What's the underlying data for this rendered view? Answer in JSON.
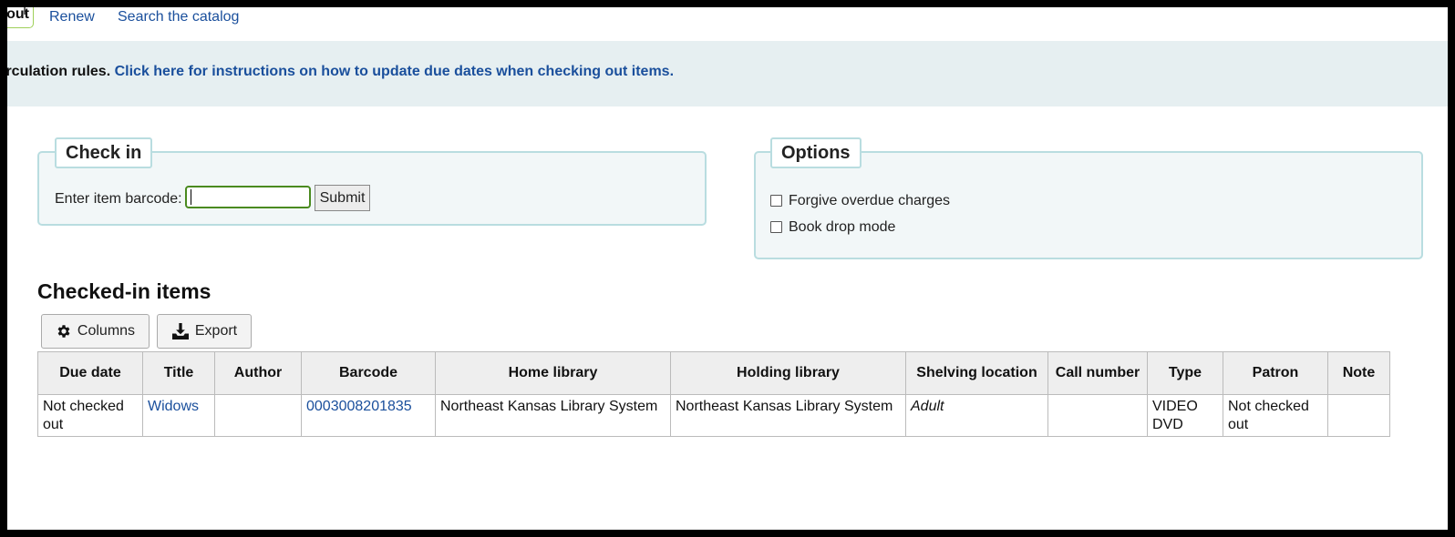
{
  "nav": {
    "active_tab_partial": "out",
    "links": [
      "Renew",
      "Search the catalog"
    ]
  },
  "banner": {
    "lead_text": "irculation rules.",
    "instructions_link": "Click here for instructions on how to update due dates when checking out items."
  },
  "checkin": {
    "legend": "Check in",
    "barcode_label": "Enter item barcode:",
    "barcode_value": "",
    "submit_label": "Submit"
  },
  "options": {
    "legend": "Options",
    "forgive_label": "Forgive overdue charges",
    "forgive_checked": false,
    "bookdrop_label": "Book drop mode",
    "bookdrop_checked": false
  },
  "checked_in": {
    "title": "Checked-in items",
    "columns_button": "Columns",
    "export_button": "Export",
    "headers": {
      "due_date": "Due date",
      "title": "Title",
      "author": "Author",
      "barcode": "Barcode",
      "home_library": "Home library",
      "holding_library": "Holding library",
      "shelving_location": "Shelving location",
      "call_number": "Call number",
      "type": "Type",
      "patron": "Patron",
      "note": "Note"
    },
    "rows": [
      {
        "due_date": "Not checked out",
        "title": "Widows",
        "author": "",
        "barcode": "0003008201835",
        "home_library": "Northeast Kansas Library System",
        "holding_library": "Northeast Kansas Library System",
        "shelving_location": "Adult",
        "call_number": "",
        "type": "VIDEO DVD",
        "patron": "Not checked out",
        "note": ""
      }
    ]
  },
  "colors": {
    "link": "#1a4f9c",
    "banner_bg": "#e6eff1",
    "fieldset_border": "#b9dde0",
    "fieldset_bg": "#f2f7f8",
    "focus_border": "#4a8a1f"
  }
}
